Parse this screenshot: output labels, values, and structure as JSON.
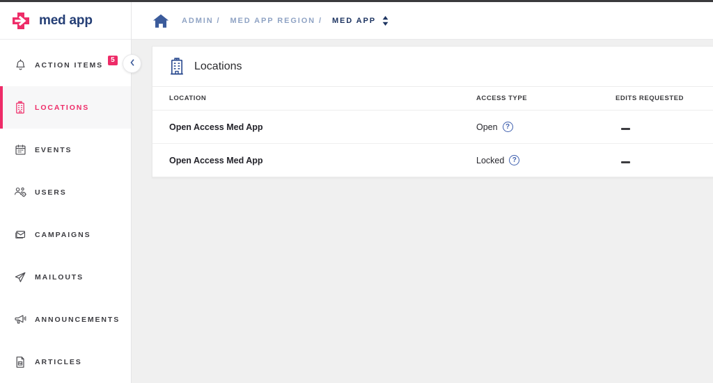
{
  "brand": {
    "name": "med app",
    "logo_icon": "medical-cross-arrow-icon",
    "accent_color": "#ee2c68"
  },
  "sidebar": {
    "collapse_icon": "chevron-left-icon",
    "items": [
      {
        "label": "Action Items",
        "icon": "bell-icon",
        "active": false,
        "badge": "5"
      },
      {
        "label": "Locations",
        "icon": "hospital-icon",
        "active": true,
        "badge": ""
      },
      {
        "label": "Events",
        "icon": "calendar-icon",
        "active": false,
        "badge": ""
      },
      {
        "label": "Users",
        "icon": "users-gear-icon",
        "active": false,
        "badge": ""
      },
      {
        "label": "Campaigns",
        "icon": "campaign-icon",
        "active": false,
        "badge": ""
      },
      {
        "label": "Mailouts",
        "icon": "paper-plane-icon",
        "active": false,
        "badge": ""
      },
      {
        "label": "Announcements",
        "icon": "megaphone-icon",
        "active": false,
        "badge": ""
      },
      {
        "label": "Articles",
        "icon": "article-icon",
        "active": false,
        "badge": ""
      }
    ]
  },
  "topbar": {
    "home_icon": "home-icon",
    "breadcrumbs": [
      {
        "label": "Admin /",
        "current": false
      },
      {
        "label": "Med App Region /",
        "current": false
      },
      {
        "label": "Med App",
        "current": true
      }
    ],
    "sort_icon": "sort-up-down-icon",
    "link_color": "#8fa3c4",
    "current_color": "#1d3461"
  },
  "card": {
    "icon": "hospital-building-icon",
    "title": "Locations",
    "table": {
      "columns": [
        "Location",
        "Access Type",
        "Edits Requested"
      ],
      "rows": [
        {
          "location": "Open Access Med App",
          "access_type": "Open",
          "access_help_icon": "question-mark-icon",
          "edits_requested": "—"
        },
        {
          "location": "Open Access Med App",
          "access_type": "Locked",
          "access_help_icon": "question-mark-icon",
          "edits_requested": "—"
        }
      ]
    }
  }
}
